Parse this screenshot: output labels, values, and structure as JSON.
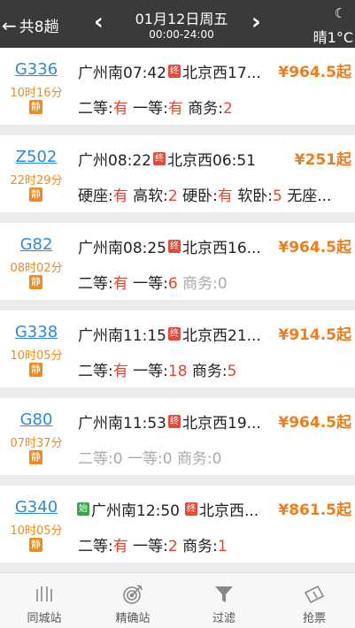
{
  "header": {
    "back_label": "共8趟",
    "date": "01月12日周五",
    "time_range": "00:00-24:00",
    "weather": "晴1°C"
  },
  "trains": [
    {
      "code": "G336",
      "duration": "10时16分",
      "quiet": "静",
      "start_badge": "",
      "from": "广州南07:42",
      "end_badge": "终",
      "to": "北京西17...",
      "price": "¥964.5起",
      "seats": [
        {
          "name": "二等:",
          "value": "有",
          "state": "avail"
        },
        {
          "name": "一等:",
          "value": "有",
          "state": "avail"
        },
        {
          "name": "商务:",
          "value": "2",
          "state": "avail"
        }
      ]
    },
    {
      "code": "Z502",
      "duration": "22时29分",
      "quiet": "静",
      "start_badge": "",
      "from": "广州08:22",
      "end_badge": "终",
      "to": "北京西06:51",
      "price": "¥251起",
      "seats": [
        {
          "name": "硬座:",
          "value": "有",
          "state": "avail"
        },
        {
          "name": "高软:",
          "value": "2",
          "state": "avail"
        },
        {
          "name": "硬卧:",
          "value": "有",
          "state": "avail"
        },
        {
          "name": "软卧:",
          "value": "5",
          "state": "avail"
        },
        {
          "name": "无座...",
          "value": "",
          "state": "avail"
        }
      ]
    },
    {
      "code": "G82",
      "duration": "08时02分",
      "quiet": "静",
      "start_badge": "",
      "from": "广州南08:25",
      "end_badge": "终",
      "to": "北京西16...",
      "price": "¥964.5起",
      "seats": [
        {
          "name": "二等:",
          "value": "有",
          "state": "avail"
        },
        {
          "name": "一等:",
          "value": "6",
          "state": "avail"
        },
        {
          "name": "商务:",
          "value": "0",
          "state": "none"
        }
      ]
    },
    {
      "code": "G338",
      "duration": "10时05分",
      "quiet": "静",
      "start_badge": "",
      "from": "广州南11:15",
      "end_badge": "终",
      "to": "北京西21...",
      "price": "¥914.5起",
      "seats": [
        {
          "name": "二等:",
          "value": "有",
          "state": "avail"
        },
        {
          "name": "一等:",
          "value": "18",
          "state": "avail"
        },
        {
          "name": "商务:",
          "value": "5",
          "state": "avail"
        }
      ]
    },
    {
      "code": "G80",
      "duration": "07时37分",
      "quiet": "静",
      "start_badge": "",
      "from": "广州南11:53",
      "end_badge": "终",
      "to": "北京西19...",
      "price": "¥964.5起",
      "seats": [
        {
          "name": "二等:",
          "value": "0",
          "state": "none"
        },
        {
          "name": "一等:",
          "value": "0",
          "state": "none"
        },
        {
          "name": "商务:",
          "value": "0",
          "state": "none"
        }
      ]
    },
    {
      "code": "G340",
      "duration": "10时05分",
      "quiet": "静",
      "start_badge": "始",
      "from": "广州南12:50",
      "end_badge": "终",
      "to": "北京西...",
      "price": "¥861.5起",
      "seats": [
        {
          "name": "二等:",
          "value": "有",
          "state": "avail"
        },
        {
          "name": "一等:",
          "value": "2",
          "state": "avail"
        },
        {
          "name": "商务:",
          "value": "1",
          "state": "avail"
        }
      ]
    }
  ],
  "tabs": [
    {
      "label": "同城站",
      "icon": "same-city-icon"
    },
    {
      "label": "精确站",
      "icon": "target-icon"
    },
    {
      "label": "过滤",
      "icon": "filter-icon"
    },
    {
      "label": "抢票",
      "icon": "ticket-icon"
    }
  ],
  "colors": {
    "header_bg": "#3a3a3a",
    "train_code": "#2e8bd4",
    "duration": "#f08a1c",
    "price": "#f07d1b",
    "available": "#e8442d",
    "unavailable": "#aaaaaa"
  }
}
